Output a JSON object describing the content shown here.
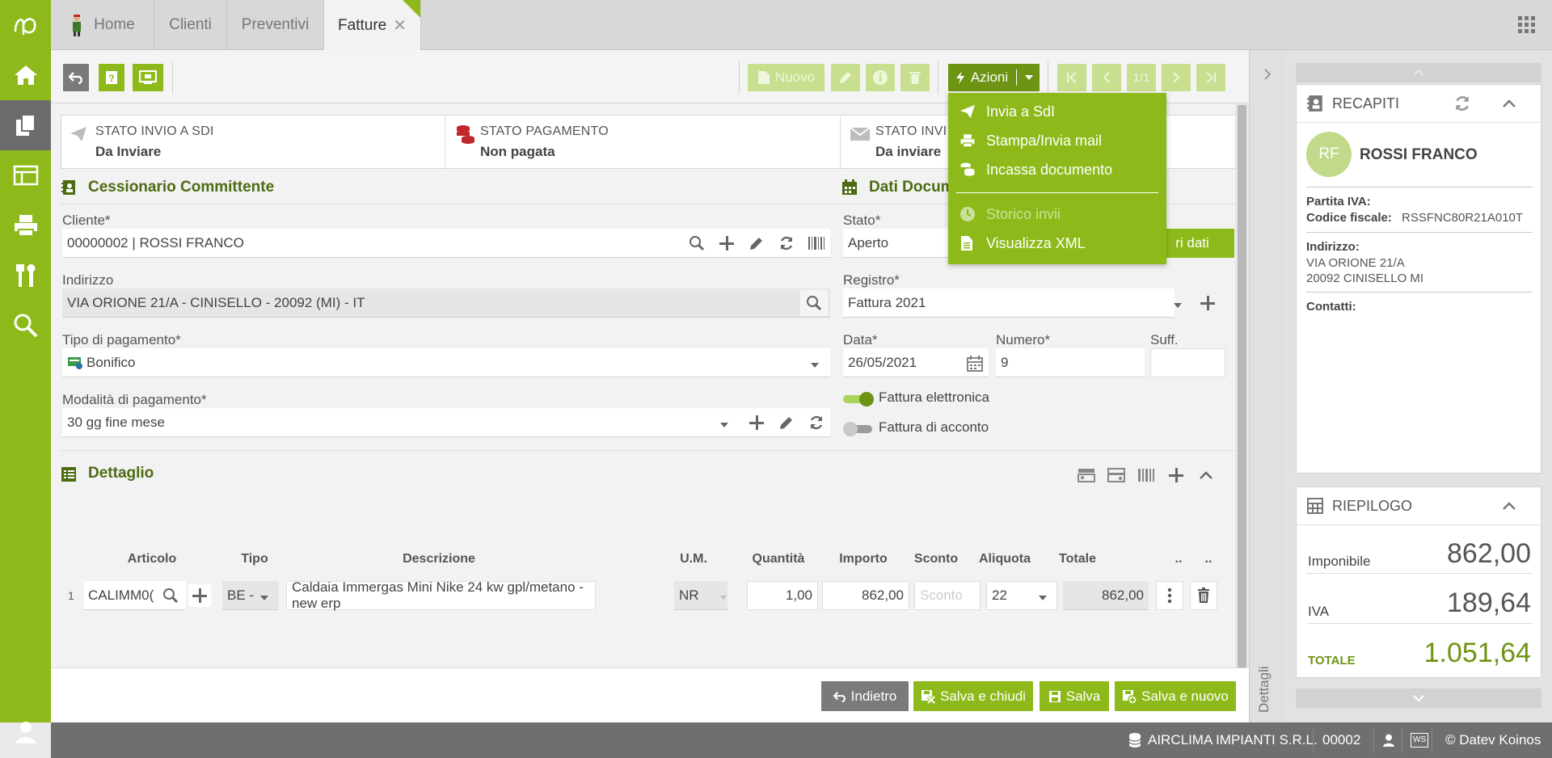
{
  "tabs": {
    "home": "Home",
    "clienti": "Clienti",
    "preventivi": "Preventivi",
    "fatture": "Fatture"
  },
  "colors": {
    "accent": "#8dba1a",
    "dark_accent": "#4d6b12",
    "payment_icon": "#c0282d"
  },
  "toolbar": {
    "nuovo": "Nuovo",
    "azioni": "Azioni",
    "pager": "1/1"
  },
  "status": {
    "sdi_label": "STATO INVIO A SDI",
    "sdi_value": "Da Inviare",
    "pay_label": "STATO PAGAMENTO",
    "pay_value": "Non pagata",
    "mail_label": "STATO INVI",
    "mail_value": "Da inviare"
  },
  "actions_menu": {
    "items": [
      "Invia a SdI",
      "Stampa/Invia mail",
      "Incassa documento",
      "Storico invii",
      "Visualizza XML"
    ]
  },
  "cessionario": {
    "title": "Cessionario Committente",
    "cliente_label": "Cliente*",
    "cliente_value": "00000002 | ROSSI  FRANCO",
    "indirizzo_label": "Indirizzo",
    "indirizzo_value": "VIA ORIONE 21/A - CINISELLO - 20092 (MI) - IT",
    "tipo_pag_label": "Tipo di pagamento*",
    "tipo_pag_value": "Bonifico",
    "mod_pag_label": "Modalità di pagamento*",
    "mod_pag_value": "30 gg fine mese"
  },
  "documento": {
    "title": "Dati Docum",
    "stato_label": "Stato*",
    "stato_value": "Aperto",
    "altri_dati": "ri dati",
    "registro_label": "Registro*",
    "registro_value": "Fattura 2021",
    "data_label": "Data*",
    "data_value": "26/05/2021",
    "numero_label": "Numero*",
    "numero_value": "9",
    "suff_label": "Suff.",
    "fattura_elettronica": "Fattura elettronica",
    "fattura_elettronica_on": true,
    "fattura_acconto": "Fattura di acconto",
    "fattura_acconto_on": false
  },
  "dettaglio": {
    "title": "Dettaglio",
    "columns": [
      "Articolo",
      "Tipo",
      "Descrizione",
      "U.M.",
      "Quantità",
      "Importo",
      "Sconto",
      "Aliquota",
      "Totale",
      "..",
      ".."
    ],
    "row": {
      "n": "1",
      "articolo": "CALIMM0(",
      "tipo": "BE -",
      "descrizione": "Caldaia Immergas Mini Nike 24 kw gpl/metano - new erp",
      "um": "NR",
      "quantita": "1,00",
      "importo": "862,00",
      "sconto_placeholder": "Sconto",
      "aliquota": "22",
      "totale": "862,00"
    }
  },
  "footer": {
    "indietro": "Indietro",
    "salva_chiudi": "Salva e chiudi",
    "salva": "Salva",
    "salva_nuovo": "Salva e nuovo"
  },
  "side_panel": {
    "vertical_label": "Dettagli"
  },
  "recapiti": {
    "title": "RECAPITI",
    "initials": "RF",
    "name": "ROSSI FRANCO",
    "piva_label": "Partita IVA:",
    "cf_label": "Codice fiscale:",
    "cf_value": "RSSFNC80R21A010T",
    "indirizzo_label": "Indirizzo:",
    "indirizzo_line1": "VIA ORIONE 21/A",
    "indirizzo_line2": "20092 CINISELLO MI",
    "contatti_label": "Contatti:"
  },
  "riepilogo": {
    "title": "RIEPILOGO",
    "imponibile_label": "Imponibile",
    "imponibile_value": "862,00",
    "iva_label": "IVA",
    "iva_value": "189,64",
    "totale_label": "TOTALE",
    "totale_value": "1.051,64"
  },
  "bottom": {
    "company": "AIRCLIMA IMPIANTI S.R.L.",
    "code": "00002",
    "ws": "WS",
    "copyright": "© Datev Koinos"
  }
}
